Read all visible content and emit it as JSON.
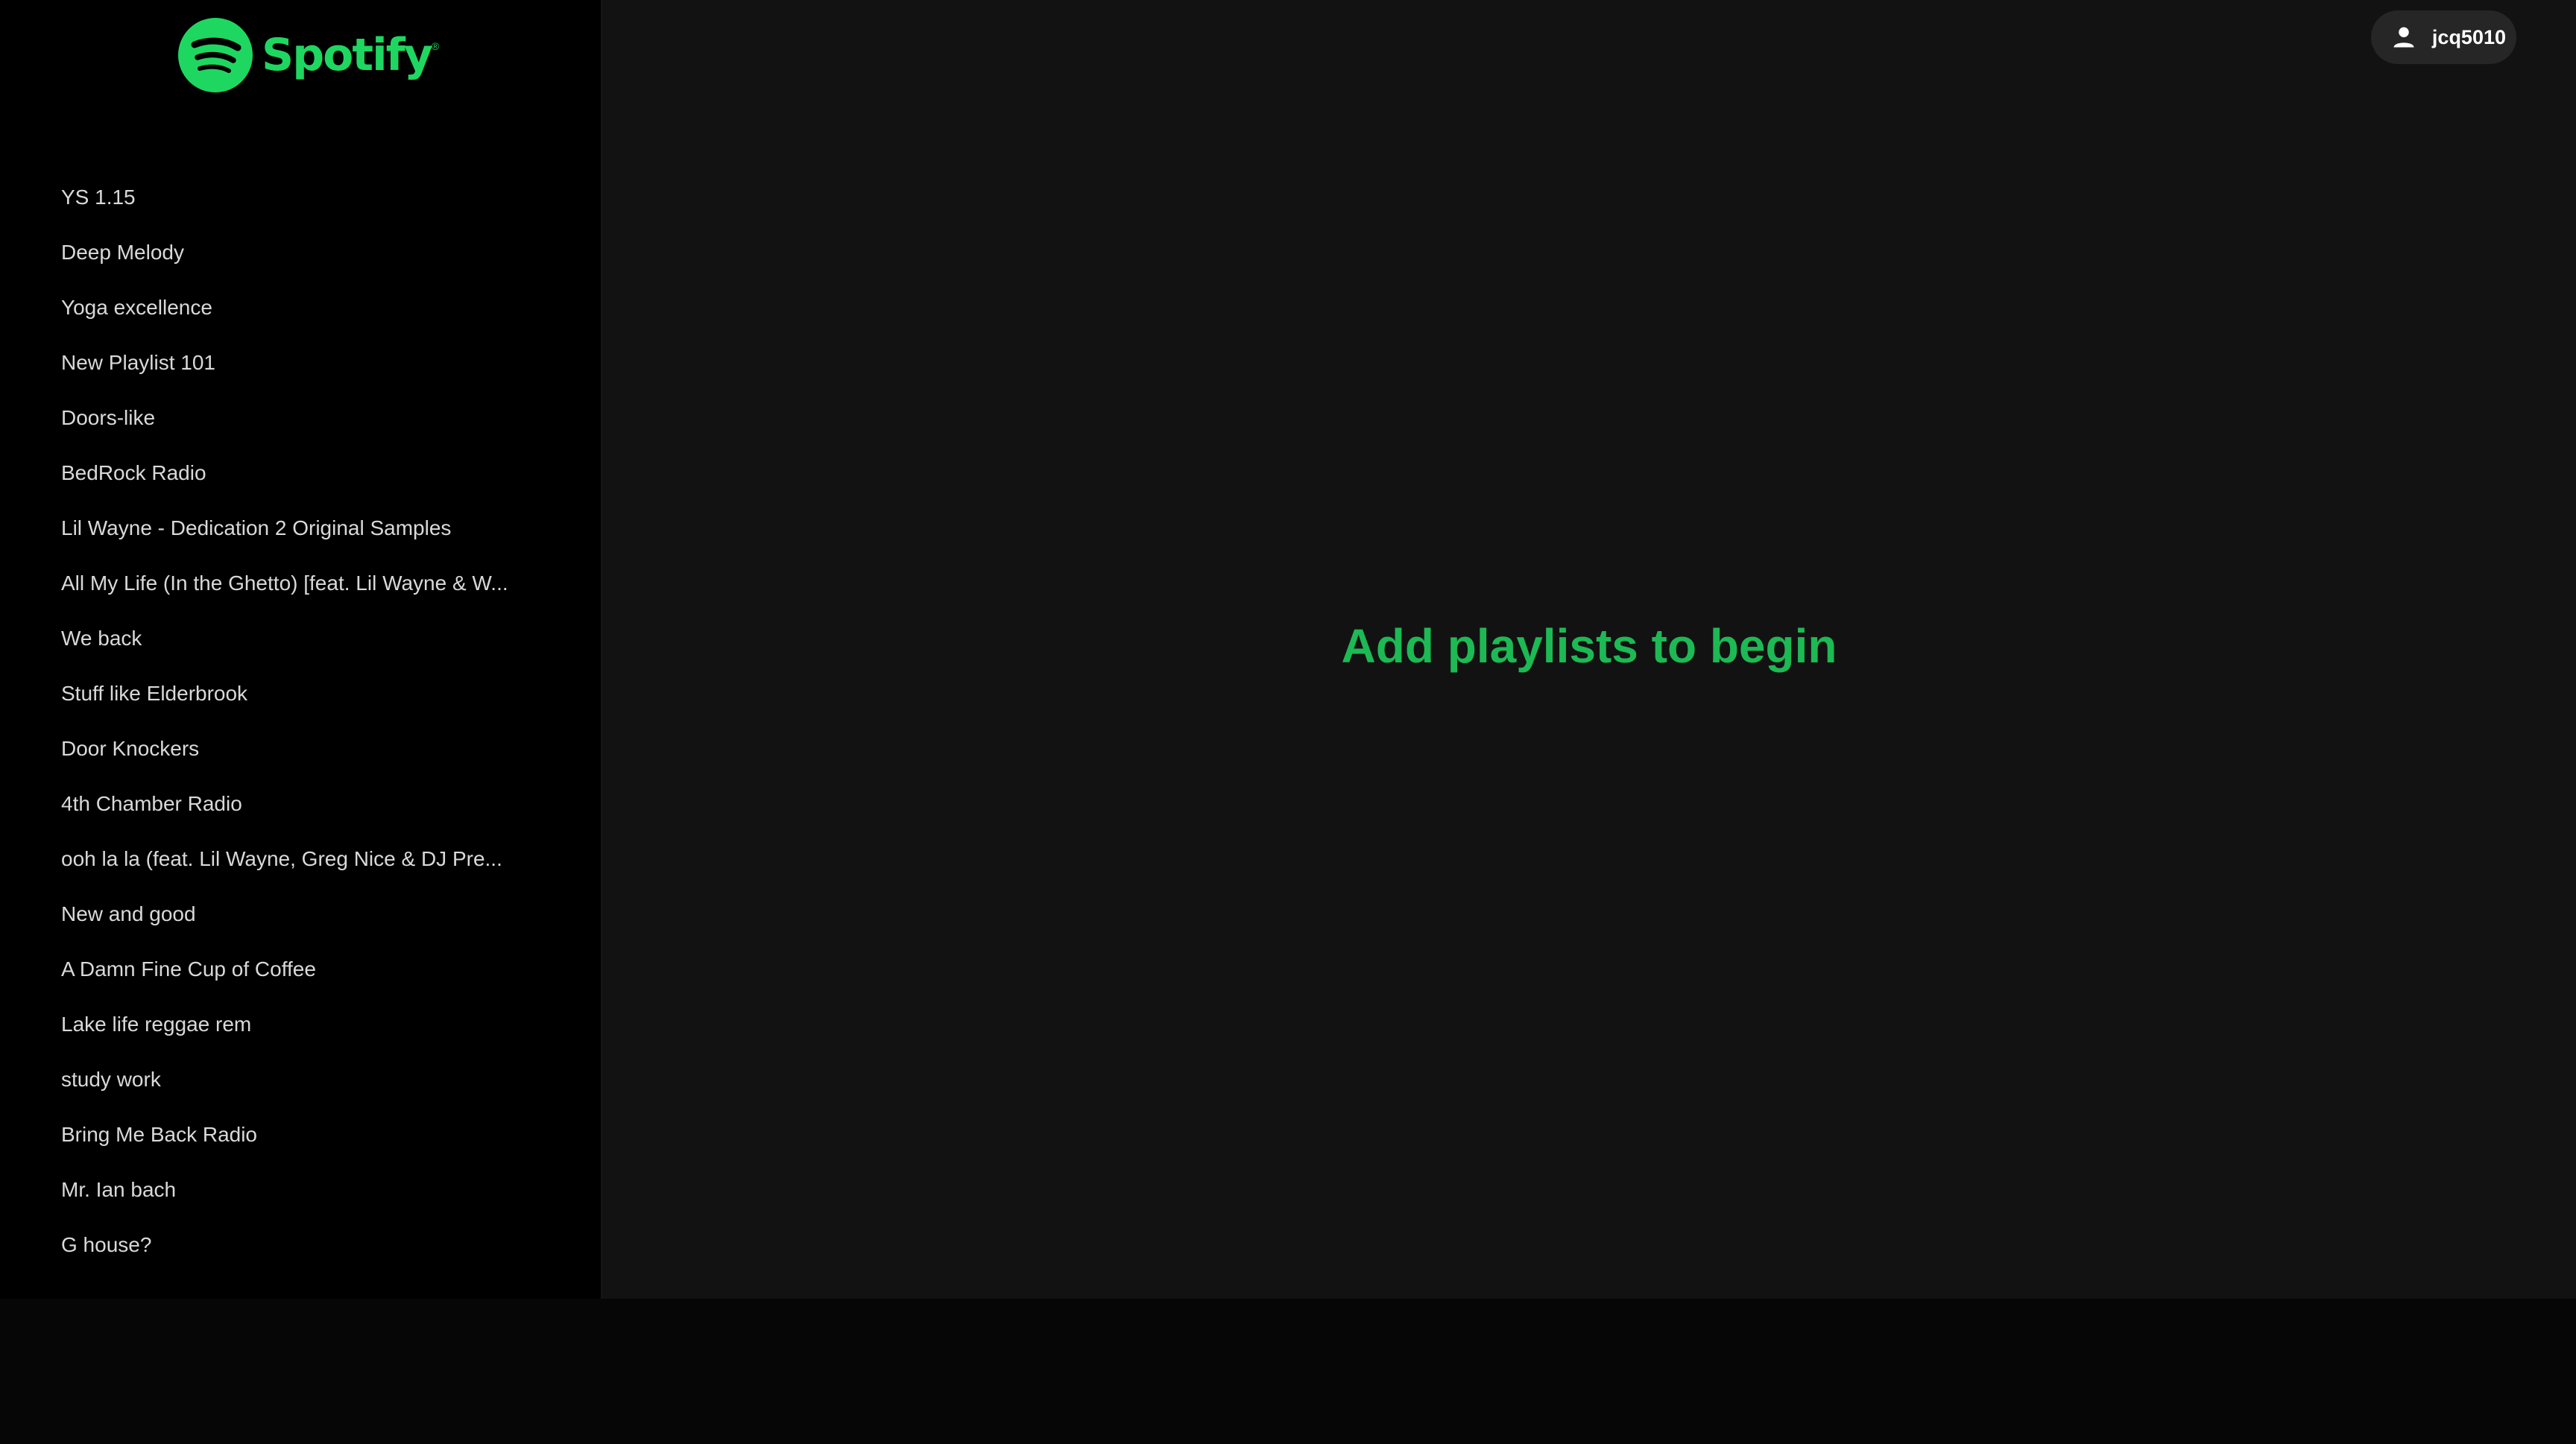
{
  "brand": {
    "name": "Spotify",
    "reg_mark": "®",
    "color": "#1ed760"
  },
  "sidebar": {
    "playlists": [
      "YS 1.15",
      "Deep Melody",
      "Yoga excellence",
      "New Playlist 101",
      "Doors-like",
      "BedRock Radio",
      "Lil Wayne - Dedication 2 Original Samples",
      "All My Life (In the Ghetto) [feat. Lil Wayne & W...",
      "We back",
      "Stuff like Elderbrook",
      "Door Knockers",
      "4th Chamber Radio",
      "ooh la la (feat. Lil Wayne, Greg Nice & DJ Pre...",
      "New and good",
      "A Damn Fine Cup of Coffee",
      "Lake life reggae rem",
      "study work",
      "Bring Me Back Radio",
      "Mr. Ian bach",
      "G house?"
    ]
  },
  "header": {
    "user": {
      "icon": "user-icon",
      "username": "jcq5010"
    }
  },
  "main": {
    "empty_message": "Add playlists to begin",
    "accent_color": "#1db954"
  }
}
